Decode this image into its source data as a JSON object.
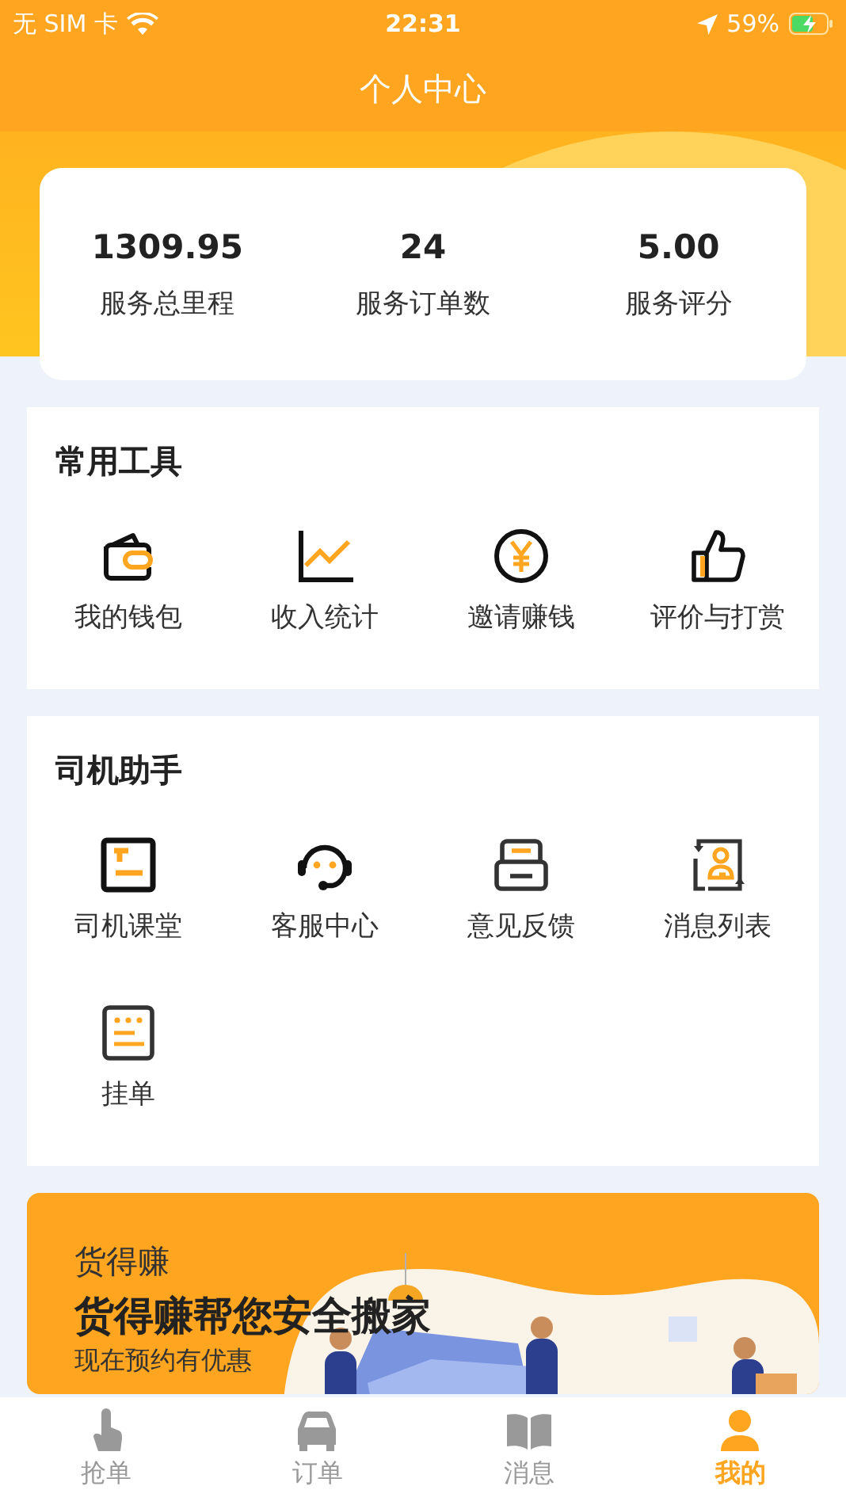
{
  "status_bar": {
    "carrier": "无 SIM 卡",
    "time": "22:31",
    "battery": "59%"
  },
  "header": {
    "title": "个人中心"
  },
  "stats": [
    {
      "value": "1309.95",
      "label": "服务总里程"
    },
    {
      "value": "24",
      "label": "服务订单数"
    },
    {
      "value": "5.00",
      "label": "服务评分"
    }
  ],
  "tools": {
    "title": "常用工具",
    "items": [
      {
        "label": "我的钱包"
      },
      {
        "label": "收入统计"
      },
      {
        "label": "邀请赚钱"
      },
      {
        "label": "评价与打赏"
      }
    ]
  },
  "assistant": {
    "title": "司机助手",
    "items": [
      {
        "label": "司机课堂"
      },
      {
        "label": "客服中心"
      },
      {
        "label": "意见反馈"
      },
      {
        "label": "消息列表"
      },
      {
        "label": "挂单"
      }
    ]
  },
  "banner": {
    "kicker": "货得赚",
    "headline": "货得赚帮您安全搬家",
    "subtitle": "现在预约有优惠"
  },
  "tab_bar": [
    {
      "label": "抢单",
      "selected": false
    },
    {
      "label": "订单",
      "selected": false
    },
    {
      "label": "消息",
      "selected": false
    },
    {
      "label": "我的",
      "selected": true
    }
  ]
}
